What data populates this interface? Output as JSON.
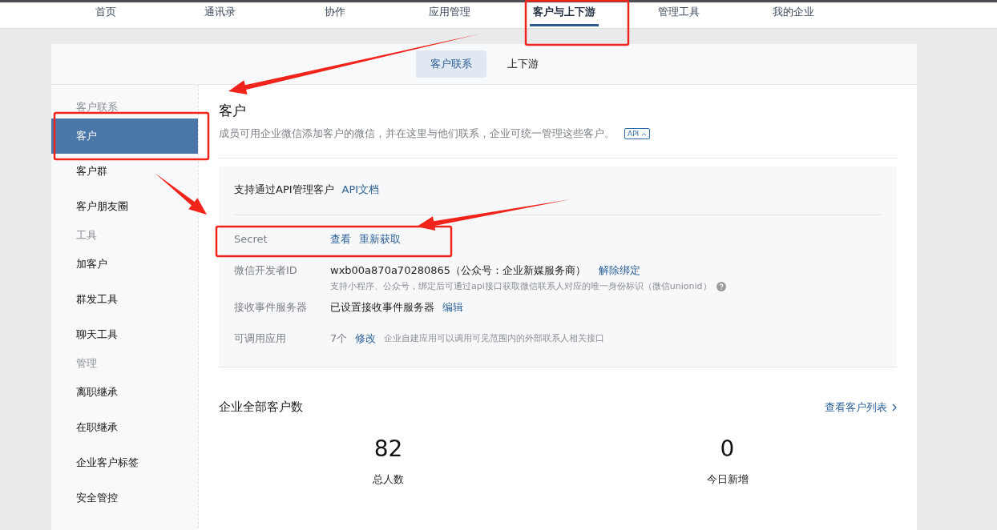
{
  "top_nav": [
    {
      "label": "首页",
      "selected": false
    },
    {
      "label": "通讯录",
      "selected": false
    },
    {
      "label": "协作",
      "selected": false
    },
    {
      "label": "应用管理",
      "selected": false
    },
    {
      "label": "客户与上下游",
      "selected": true
    },
    {
      "label": "管理工具",
      "selected": false
    },
    {
      "label": "我的企业",
      "selected": false
    }
  ],
  "sub_tabs": [
    {
      "label": "客户联系",
      "selected": true
    },
    {
      "label": "上下游",
      "selected": false
    }
  ],
  "sidebar": [
    {
      "heading": "客户联系",
      "items": [
        {
          "label": "客户",
          "selected": true
        },
        {
          "label": "客户群",
          "selected": false
        },
        {
          "label": "客户朋友圈",
          "selected": false
        }
      ]
    },
    {
      "heading": "工具",
      "items": [
        {
          "label": "加客户",
          "selected": false
        },
        {
          "label": "群发工具",
          "selected": false
        },
        {
          "label": "聊天工具",
          "selected": false
        }
      ]
    },
    {
      "heading": "管理",
      "items": [
        {
          "label": "离职继承",
          "selected": false
        },
        {
          "label": "在职继承",
          "selected": false
        },
        {
          "label": "企业客户标签",
          "selected": false
        },
        {
          "label": "安全管控",
          "selected": false
        }
      ]
    }
  ],
  "page": {
    "title": "客户",
    "description": "成员可用企业微信添加客户的微信，并在这里与他们联系，企业可统一管理这些客户。",
    "badge": "API"
  },
  "api_panel": {
    "heading": "支持通过API管理客户",
    "link": "API文档",
    "rows": [
      {
        "kind": "links",
        "label": "Secret",
        "links": [
          "查看",
          "重新获取"
        ]
      },
      {
        "kind": "detail",
        "label": "微信开发者ID",
        "value": "wxb00a870a70280865（公众号：企业新媒服务商）",
        "links": [
          "解除绑定"
        ],
        "note": "支持小程序、公众号，绑定后可通过api接口获取微信联系人对应的唯一身份标识（微信unionid）"
      },
      {
        "kind": "value",
        "label": "接收事件服务器",
        "value": "已设置接收事件服务器",
        "links": [
          "编辑"
        ]
      },
      {
        "kind": "inline_note",
        "label": "可调用应用",
        "value": "7个",
        "links": [
          "修改"
        ],
        "note": "企业自建应用可以调用可见范围内的外部联系人相关接口"
      }
    ]
  },
  "stats": {
    "title": "企业全部客户数",
    "link": "查看客户列表",
    "items": [
      {
        "value": "82",
        "label": "总人数"
      },
      {
        "value": "0",
        "label": "今日新增"
      }
    ]
  }
}
